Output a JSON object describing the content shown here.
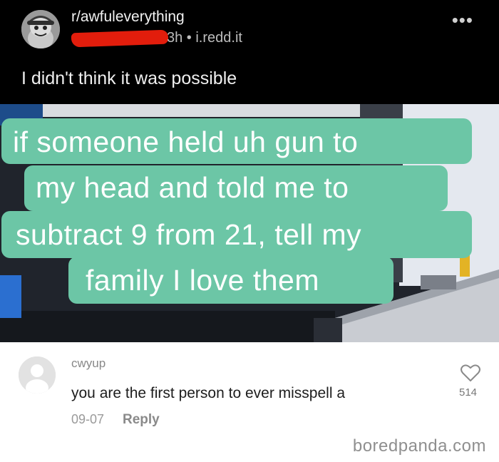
{
  "post": {
    "subreddit": "r/awfuleverything",
    "meta": "3h • i.redd.it",
    "title": "I didn't think it was possible"
  },
  "image": {
    "caption_lines": [
      "if someone held uh gun to",
      "my head and told me to",
      "subtract 9 from 21, tell my",
      "family I love them"
    ],
    "caption_color": "#6cc6a6"
  },
  "comment": {
    "username": "cwyup",
    "text": "you are the first person to ever misspell a",
    "date": "09-07",
    "reply_label": "Reply",
    "likes": "514"
  },
  "watermark": "boredpanda.com",
  "icons": {
    "more": "more-icon",
    "like": "heart-icon"
  },
  "colors": {
    "header_bg": "#000000",
    "redaction": "#e21d0c"
  }
}
